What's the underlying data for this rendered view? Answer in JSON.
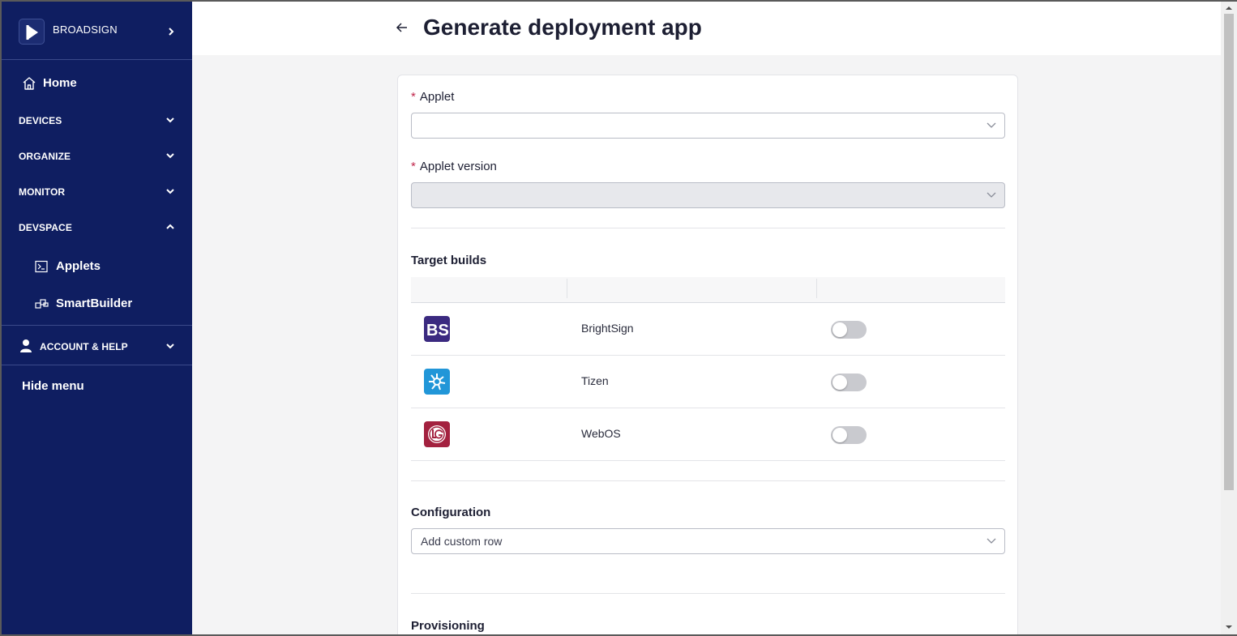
{
  "brand": {
    "name": "BROADSIGN"
  },
  "sidebar": {
    "home": "Home",
    "sections": [
      {
        "label": "DEVICES",
        "expanded": false
      },
      {
        "label": "ORGANIZE",
        "expanded": false
      },
      {
        "label": "MONITOR",
        "expanded": false
      },
      {
        "label": "DEVSPACE",
        "expanded": true
      }
    ],
    "devspace_items": [
      {
        "label": "Applets",
        "icon": "terminal-icon"
      },
      {
        "label": "SmartBuilder",
        "icon": "blocks-icon"
      }
    ],
    "account": {
      "label": "ACCOUNT & HELP",
      "icon": "user-icon"
    },
    "hide_menu": "Hide menu"
  },
  "header": {
    "title": "Generate deployment app"
  },
  "form": {
    "applet": {
      "label": "Applet",
      "value": "",
      "required": true
    },
    "applet_version": {
      "label": "Applet version",
      "value": "",
      "required": true,
      "disabled": true
    },
    "target_builds": {
      "title": "Target builds",
      "rows": [
        {
          "name": "BrightSign",
          "logo": "brightsign-logo",
          "enabled": false
        },
        {
          "name": "Tizen",
          "logo": "tizen-logo",
          "enabled": false
        },
        {
          "name": "WebOS",
          "logo": "webos-logo",
          "enabled": false
        }
      ]
    },
    "configuration": {
      "title": "Configuration",
      "select_value": "Add custom row"
    },
    "provisioning": {
      "title": "Provisioning"
    }
  },
  "colors": {
    "sidebar_bg": "#0f1e61",
    "required": "#c0264b",
    "brightsign": "#3b2a80",
    "tizen": "#2196d8",
    "webos": "#a3213f"
  }
}
